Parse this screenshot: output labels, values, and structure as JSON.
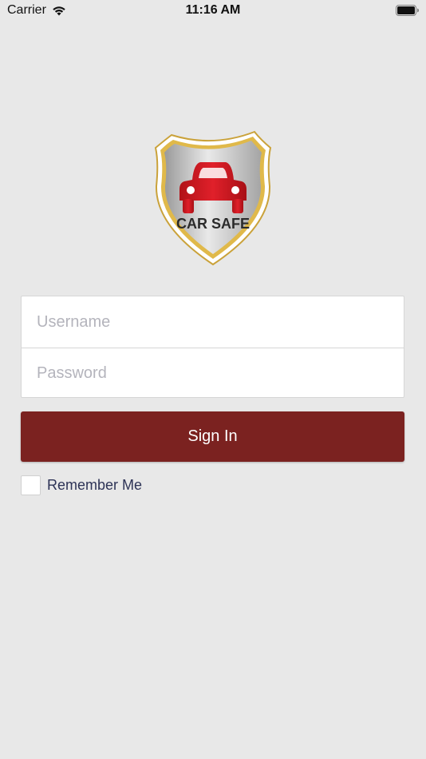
{
  "status_bar": {
    "carrier": "Carrier",
    "time": "11:16 AM",
    "icons": [
      "wifi-icon",
      "battery-icon"
    ]
  },
  "logo": {
    "text": "CAR SAFE",
    "icon": "car-shield-logo",
    "colors": {
      "car": "#c4161c",
      "border": "#d4aa3a",
      "shield": "#c8c8c8"
    }
  },
  "login_form": {
    "username_placeholder": "Username",
    "password_placeholder": "Password",
    "username_value": "",
    "password_value": ""
  },
  "signin": {
    "label": "Sign In",
    "color": "#7b2220"
  },
  "remember": {
    "label": "Remember Me",
    "checked": false
  }
}
